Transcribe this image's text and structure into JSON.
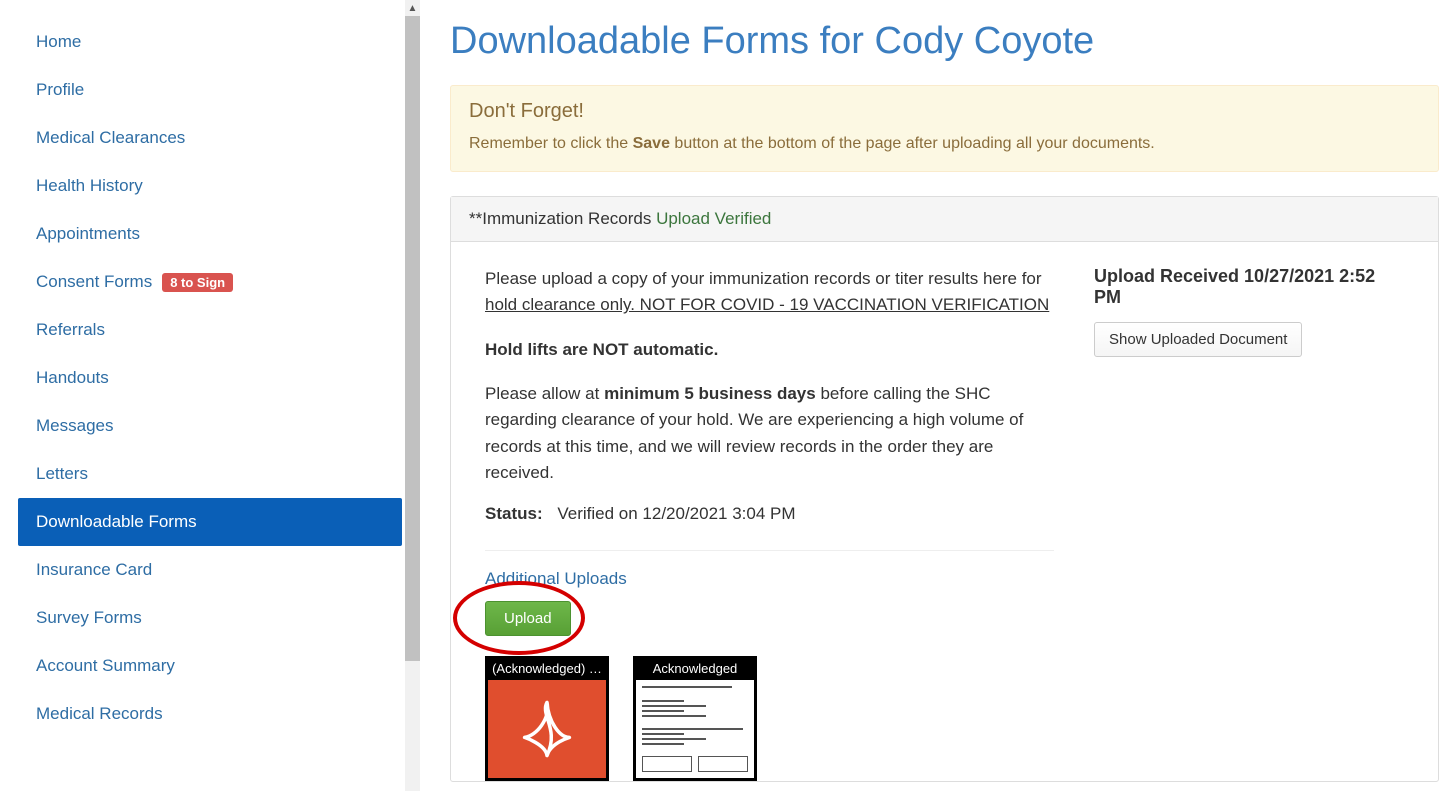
{
  "sidebar": {
    "items": [
      {
        "label": "Home"
      },
      {
        "label": "Profile"
      },
      {
        "label": "Medical Clearances"
      },
      {
        "label": "Health History"
      },
      {
        "label": "Appointments"
      },
      {
        "label": "Consent Forms",
        "badge": "8 to Sign"
      },
      {
        "label": "Referrals"
      },
      {
        "label": "Handouts"
      },
      {
        "label": "Messages"
      },
      {
        "label": "Letters"
      },
      {
        "label": "Downloadable Forms",
        "active": true
      },
      {
        "label": "Insurance Card"
      },
      {
        "label": "Survey Forms"
      },
      {
        "label": "Account Summary"
      },
      {
        "label": "Medical Records"
      }
    ]
  },
  "page": {
    "title": "Downloadable Forms for Cody Coyote"
  },
  "alert": {
    "title": "Don't Forget!",
    "text_before": "Remember to click the ",
    "text_bold": "Save",
    "text_after": " button at the bottom of the page after uploading all your documents."
  },
  "panel": {
    "header_prefix": "**Immunization Records ",
    "header_status": "Upload Verified",
    "instr1_before": "Please upload a copy of your immunization records or titer results here for ",
    "instr1_underline": "hold clearance only. NOT FOR COVID - 19 VACCINATION VERIFICATION",
    "instr2": "Hold lifts are NOT automatic.",
    "instr3_before": "Please allow at ",
    "instr3_bold": "minimum 5 business days",
    "instr3_after": " before calling the SHC regarding clearance of your hold. We are experiencing a high volume of records at this time, and we will review records in the order they are received.",
    "status_label": "Status:",
    "status_value": "Verified on 12/20/2021 3:04 PM",
    "additional_title": "Additional Uploads",
    "upload_button": "Upload",
    "thumbs": [
      {
        "label": "(Acknowledged) …",
        "type": "pdf"
      },
      {
        "label": "Acknowledged",
        "type": "doc"
      }
    ]
  },
  "right": {
    "title": "Upload Received 10/27/2021 2:52 PM",
    "show_button": "Show Uploaded Document"
  },
  "colors": {
    "link": "#2e6da4",
    "active_bg": "#0a5fb7",
    "badge_bg": "#d9534f",
    "alert_bg": "#fcf8e3",
    "alert_text": "#8a6d3b",
    "verified": "#3c763d",
    "btn_green": "#58a035",
    "annotation_ellipse": "#d40000"
  }
}
